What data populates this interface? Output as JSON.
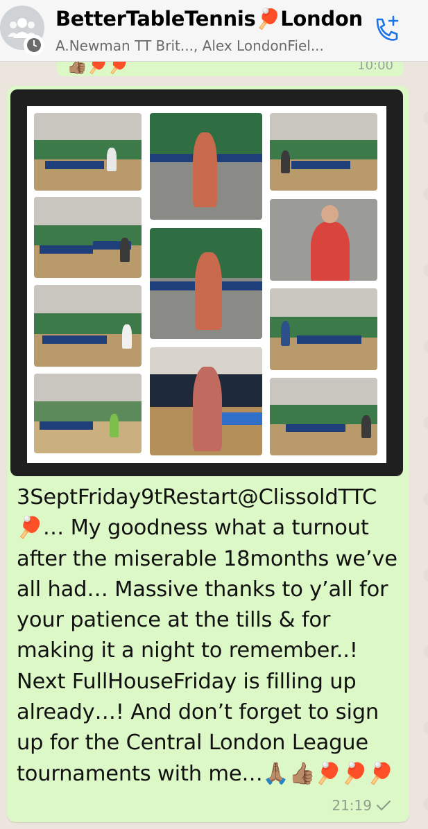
{
  "header": {
    "title": "BetterTableTennis🏓London",
    "subtitle": "A.Newman TT Brit..., Alex LondonFiel...",
    "call_icon": "phone-add-icon",
    "avatar_icon": "group-avatar-icon"
  },
  "previous_message": {
    "emoji": "👍🏽🏓🏓",
    "time": "10:00"
  },
  "message": {
    "text": "3SeptFriday9tRestart@ClissoldTTC 🏓… My goodness what a turnout after the miserable 18months we’ve all had… Massive thanks to y’all for your patience at the tills & for making it a night to remember..! Next FullHouseFriday is filling up already…! And don’t forget to sign up for the Central London League tournaments with me…🙏🏽👍🏽🏓🏓🏓",
    "time": "21:19",
    "status": "sent-tick-icon"
  },
  "colors": {
    "bubble": "#dcf8c6",
    "header": "#f6f6f6",
    "accent": "#1a73e8"
  }
}
